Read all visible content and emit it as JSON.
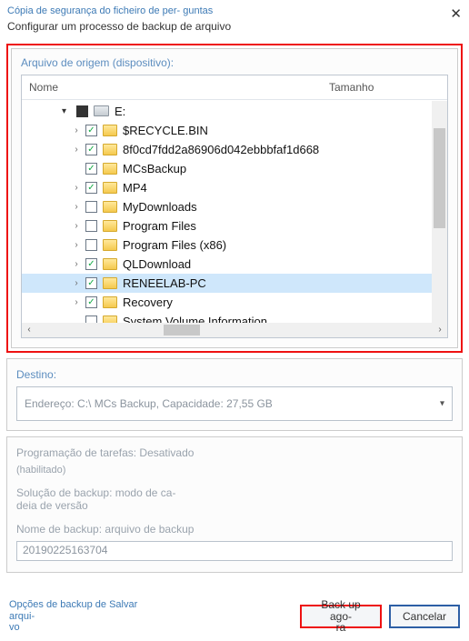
{
  "window": {
    "title": "Cópia de segurança do ficheiro de per-\nguntas",
    "subtitle": "Configurar um processo de backup de\narquivo"
  },
  "source": {
    "label": "Arquivo de origem (dispositivo):",
    "columns": {
      "name": "Nome",
      "size": "Tamanho"
    },
    "root": {
      "label": "E:"
    },
    "items": [
      {
        "label": "$RECYCLE.BIN",
        "checked": true,
        "expandable": true,
        "selected": false
      },
      {
        "label": "8f0cd7fdd2a86906d042ebbbfaf1d668",
        "checked": true,
        "expandable": true,
        "selected": false
      },
      {
        "label": "MCsBackup",
        "checked": true,
        "expandable": false,
        "selected": false
      },
      {
        "label": "MP4",
        "checked": true,
        "expandable": true,
        "selected": false
      },
      {
        "label": "MyDownloads",
        "checked": false,
        "expandable": true,
        "selected": false
      },
      {
        "label": "Program Files",
        "checked": false,
        "expandable": true,
        "selected": false
      },
      {
        "label": "Program Files (x86)",
        "checked": false,
        "expandable": true,
        "selected": false
      },
      {
        "label": "QLDownload",
        "checked": true,
        "expandable": true,
        "selected": false
      },
      {
        "label": "RENEELAB-PC",
        "checked": true,
        "expandable": true,
        "selected": true
      },
      {
        "label": "Recovery",
        "checked": true,
        "expandable": true,
        "selected": false
      },
      {
        "label": "System Volume Information",
        "checked": false,
        "expandable": false,
        "selected": false
      }
    ]
  },
  "dest": {
    "label": "Destino:",
    "value": "Endereço: C:\\ MCs Backup, Capacidade: 27,55 GB"
  },
  "schedule": {
    "label": "Programação de tarefas: Desativado",
    "enabled_note": "(habilitado)"
  },
  "solution": {
    "label": "Solução de backup: modo de ca-\ndeia de versão"
  },
  "backup_name": {
    "label": "Nome de backup: arquivo de backup",
    "value": "20190225163704"
  },
  "footer": {
    "options_link": "Opções de backup de Salvar arqui-\nvo",
    "backup_now": "Back up ago-\nra",
    "cancel": "Cancelar"
  }
}
